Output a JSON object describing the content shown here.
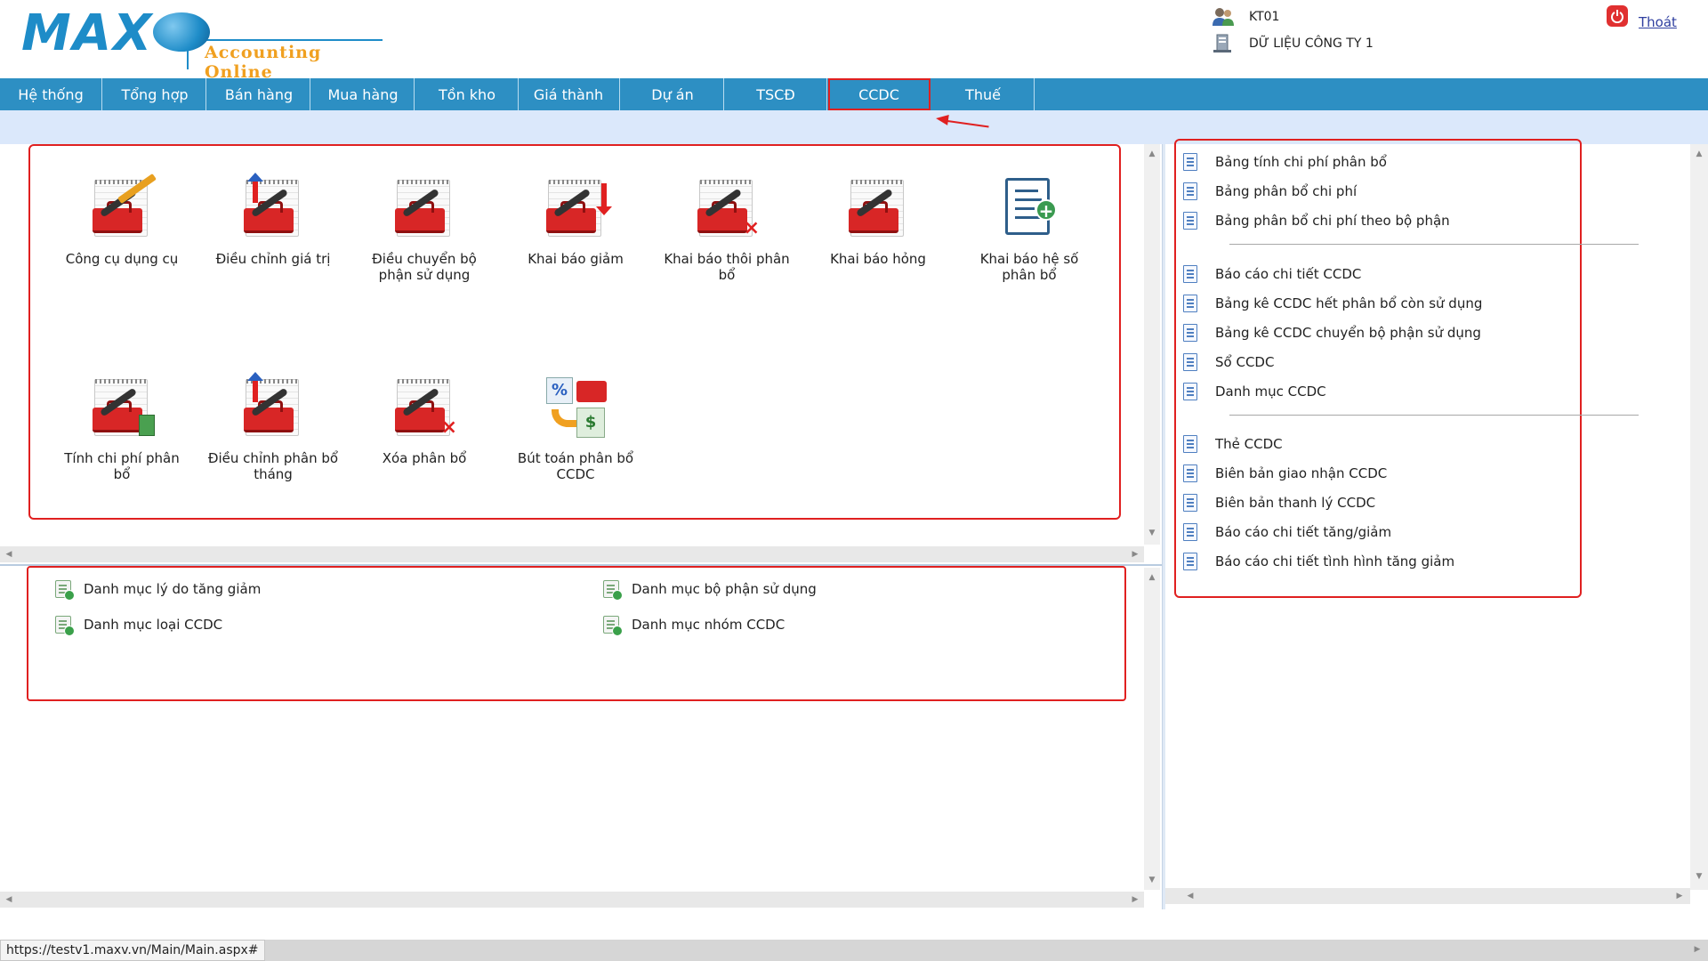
{
  "header": {
    "logo_text": "MAX",
    "logo_subtitle": "Accounting Online",
    "user": "KT01",
    "company": "DỮ LIỆU CÔNG TY 1",
    "logout": "Thoát"
  },
  "nav": {
    "items": [
      "Hệ thống",
      "Tổng hợp",
      "Bán hàng",
      "Mua hàng",
      "Tồn kho",
      "Giá thành",
      "Dự án",
      "TSCĐ",
      "CCDC",
      "Thuế"
    ],
    "active": "CCDC"
  },
  "functions": [
    {
      "label": "Công cụ dụng cụ",
      "icon": "toolbox-pencil-icon"
    },
    {
      "label": "Điều chỉnh giá trị",
      "icon": "toolbox-adjust-icon"
    },
    {
      "label": "Điều chuyển bộ phận sử dụng",
      "icon": "toolbox-transfer-icon"
    },
    {
      "label": "Khai báo giảm",
      "icon": "toolbox-decrease-icon"
    },
    {
      "label": "Khai báo thôi phân bổ",
      "icon": "toolbox-stop-icon"
    },
    {
      "label": "Khai báo hỏng",
      "icon": "toolbox-broken-icon"
    },
    {
      "label": "Khai báo hệ số phân bổ",
      "icon": "document-plus-icon"
    },
    {
      "label": "Tính chi phí phân bổ",
      "icon": "toolbox-calculator-icon"
    },
    {
      "label": "Điều chỉnh phân bổ tháng",
      "icon": "toolbox-adjust-month-icon"
    },
    {
      "label": "Xóa phân bổ",
      "icon": "toolbox-delete-icon"
    },
    {
      "label": "Bút toán phân bổ CCDC",
      "icon": "journal-entry-icon"
    }
  ],
  "catalogs": [
    "Danh mục lý do tăng giảm",
    "Danh mục bộ phận sử dụng",
    "Danh mục loại CCDC",
    "Danh mục nhóm CCDC"
  ],
  "reports": {
    "group1": [
      "Bảng tính chi phí phân bổ",
      "Bảng phân bổ chi phí",
      "Bảng phân bổ chi phí theo bộ phận"
    ],
    "group2": [
      "Báo cáo chi tiết CCDC",
      "Bảng kê CCDC hết phân bổ còn sử dụng",
      "Bảng kê CCDC chuyển bộ phận sử dụng",
      "Sổ CCDC",
      "Danh mục CCDC"
    ],
    "group3": [
      "Thẻ CCDC",
      "Biên bản giao nhận CCDC",
      "Biên bản thanh lý CCDC",
      "Báo cáo chi tiết tăng/giảm",
      "Báo cáo chi tiết tình hình tăng giảm"
    ]
  },
  "status": {
    "url": "https://testv1.maxv.vn/Main/Main.aspx#"
  },
  "colors": {
    "nav_bg": "#2d8fc3",
    "highlight": "#e02020",
    "subbar_bg": "#dbe8fb"
  }
}
